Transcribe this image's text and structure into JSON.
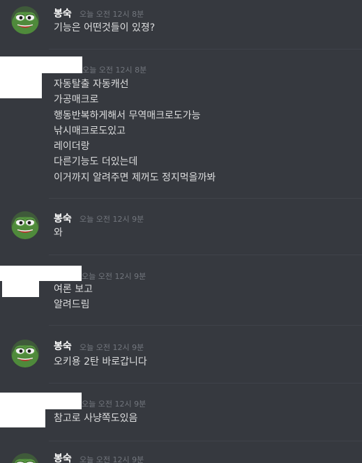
{
  "messages": [
    {
      "author": "봉숙",
      "timestamp": "오늘 오전 12시 8분",
      "avatar": "pepe-frog-avatar",
      "lines": [
        "기능은 어떤것들이 있졍?"
      ]
    },
    {
      "author": "",
      "timestamp": "오늘 오전 12시 8분",
      "avatar": "redacted",
      "lines": [
        "자동탈출 자동캐선",
        "가공매크로",
        "행동반복하게해서 무역매크로도가능",
        "낚시매크로도있고",
        "레이더랑",
        "다른기능도 더있는데",
        "이거까지 알려주면 제꺼도 정지먹을까봐"
      ]
    },
    {
      "author": "봉숙",
      "timestamp": "오늘 오전 12시 9분",
      "avatar": "pepe-frog-avatar",
      "lines": [
        "와"
      ]
    },
    {
      "author": "",
      "timestamp": "오늘 오전 12시 9분",
      "avatar": "redacted",
      "lines": [
        "여론 보고",
        "알려드림"
      ]
    },
    {
      "author": "봉숙",
      "timestamp": "오늘 오전 12시 9분",
      "avatar": "pepe-frog-avatar",
      "lines": [
        "오키용 2탄 바로갑니다"
      ]
    },
    {
      "author": "",
      "timestamp": "오늘 오전 12시 9분",
      "avatar": "redacted",
      "lines": [
        "참고로 사냥쪽도있음"
      ]
    },
    {
      "author": "봉숙",
      "timestamp": "오늘 오전 12시 9분",
      "avatar": "pepe-frog-avatar",
      "lines": []
    }
  ],
  "colors": {
    "background": "#36393f",
    "author": "#ffffff",
    "timestamp": "#72767d",
    "message_text": "#dcddde",
    "divider": "#40434a"
  }
}
